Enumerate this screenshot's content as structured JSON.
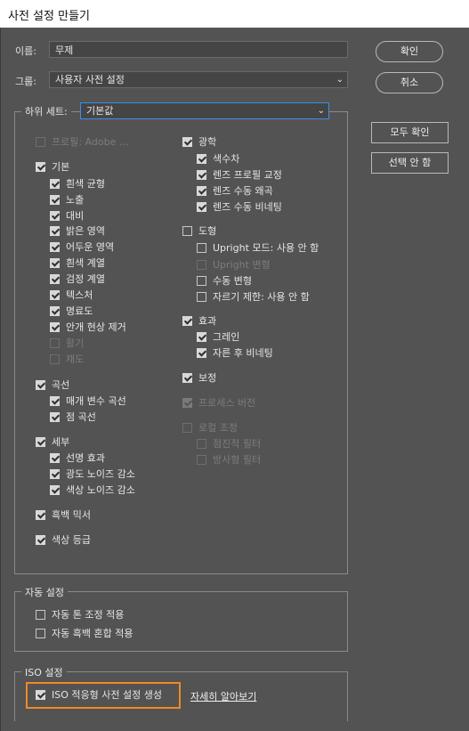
{
  "window": {
    "title": "사전 설정 만들기"
  },
  "form": {
    "name_label": "이름:",
    "name_value": "무제",
    "group_label": "그룹:",
    "group_value": "사용자 사전 설정",
    "subset_label": "하위 세트:",
    "subset_value": "기본값"
  },
  "buttons": {
    "ok": "확인",
    "cancel": "취소",
    "check_all": "모두 확인",
    "check_none": "선택 안 함"
  },
  "left_column": [
    {
      "label": "프로필: Adobe ...",
      "checked": false,
      "disabled": true,
      "indent": 0
    },
    {
      "label": "기본",
      "checked": true,
      "disabled": false,
      "indent": 0
    },
    {
      "label": "흰색 균형",
      "checked": true,
      "disabled": false,
      "indent": 1
    },
    {
      "label": "노출",
      "checked": true,
      "disabled": false,
      "indent": 1
    },
    {
      "label": "대비",
      "checked": true,
      "disabled": false,
      "indent": 1
    },
    {
      "label": "밝은 영역",
      "checked": true,
      "disabled": false,
      "indent": 1
    },
    {
      "label": "어두운 영역",
      "checked": true,
      "disabled": false,
      "indent": 1
    },
    {
      "label": "흰색 계열",
      "checked": true,
      "disabled": false,
      "indent": 1
    },
    {
      "label": "검정 계열",
      "checked": true,
      "disabled": false,
      "indent": 1
    },
    {
      "label": "텍스처",
      "checked": true,
      "disabled": false,
      "indent": 1
    },
    {
      "label": "명료도",
      "checked": true,
      "disabled": false,
      "indent": 1
    },
    {
      "label": "안개 현상 제거",
      "checked": true,
      "disabled": false,
      "indent": 1
    },
    {
      "label": "활기",
      "checked": false,
      "disabled": true,
      "indent": 1
    },
    {
      "label": "채도",
      "checked": false,
      "disabled": true,
      "indent": 1
    },
    {
      "label": "곡선",
      "checked": true,
      "disabled": false,
      "indent": 0
    },
    {
      "label": "매개 변수 곡선",
      "checked": true,
      "disabled": false,
      "indent": 1
    },
    {
      "label": "점 곡선",
      "checked": true,
      "disabled": false,
      "indent": 1
    },
    {
      "label": "세부",
      "checked": true,
      "disabled": false,
      "indent": 0
    },
    {
      "label": "선명 효과",
      "checked": true,
      "disabled": false,
      "indent": 1
    },
    {
      "label": "광도 노이즈 감소",
      "checked": true,
      "disabled": false,
      "indent": 1
    },
    {
      "label": "색상 노이즈 감소",
      "checked": true,
      "disabled": false,
      "indent": 1
    },
    {
      "label": "흑백 믹서",
      "checked": true,
      "disabled": false,
      "indent": 0
    },
    {
      "label": "색상 등급",
      "checked": true,
      "disabled": false,
      "indent": 0
    }
  ],
  "right_column": [
    {
      "label": "광학",
      "checked": true,
      "disabled": false,
      "indent": 0
    },
    {
      "label": "색수차",
      "checked": true,
      "disabled": false,
      "indent": 1
    },
    {
      "label": "렌즈 프로필 교정",
      "checked": true,
      "disabled": false,
      "indent": 1
    },
    {
      "label": "렌즈 수동 왜곡",
      "checked": true,
      "disabled": false,
      "indent": 1
    },
    {
      "label": "렌즈 수동 비네팅",
      "checked": true,
      "disabled": false,
      "indent": 1
    },
    {
      "label": "도형",
      "checked": false,
      "disabled": false,
      "indent": 0
    },
    {
      "label": "Upright 모드: 사용 안 함",
      "checked": false,
      "disabled": false,
      "indent": 1
    },
    {
      "label": "Upright 변형",
      "checked": false,
      "disabled": true,
      "indent": 1
    },
    {
      "label": "수동 변형",
      "checked": false,
      "disabled": false,
      "indent": 1
    },
    {
      "label": "자르기 제한: 사용 안 함",
      "checked": false,
      "disabled": false,
      "indent": 1
    },
    {
      "label": "효과",
      "checked": true,
      "disabled": false,
      "indent": 0
    },
    {
      "label": "그레인",
      "checked": true,
      "disabled": false,
      "indent": 1
    },
    {
      "label": "자른 후 비네팅",
      "checked": true,
      "disabled": false,
      "indent": 1
    },
    {
      "label": "보정",
      "checked": true,
      "disabled": false,
      "indent": 0
    },
    {
      "label": "프로세스 버전",
      "checked": true,
      "disabled": true,
      "indent": 0
    },
    {
      "label": "로컬 조정",
      "checked": false,
      "disabled": true,
      "indent": 0
    },
    {
      "label": "점진적 필터",
      "checked": false,
      "disabled": true,
      "indent": 1
    },
    {
      "label": "방사형 필터",
      "checked": false,
      "disabled": true,
      "indent": 1
    }
  ],
  "auto_settings": {
    "legend": "자동 설정",
    "items": [
      {
        "label": "자동 톤 조정 적용",
        "checked": false
      },
      {
        "label": "자동 흑백 혼합 적용",
        "checked": false
      }
    ]
  },
  "iso_settings": {
    "legend": "ISO 설정",
    "checkbox_label": "ISO 적응형 사전 설정 생성",
    "checked": true,
    "learn_more": "자세히 알아보기"
  },
  "colors": {
    "highlight": "#f08a24",
    "focus": "#3b8eea",
    "background": "#535353"
  }
}
